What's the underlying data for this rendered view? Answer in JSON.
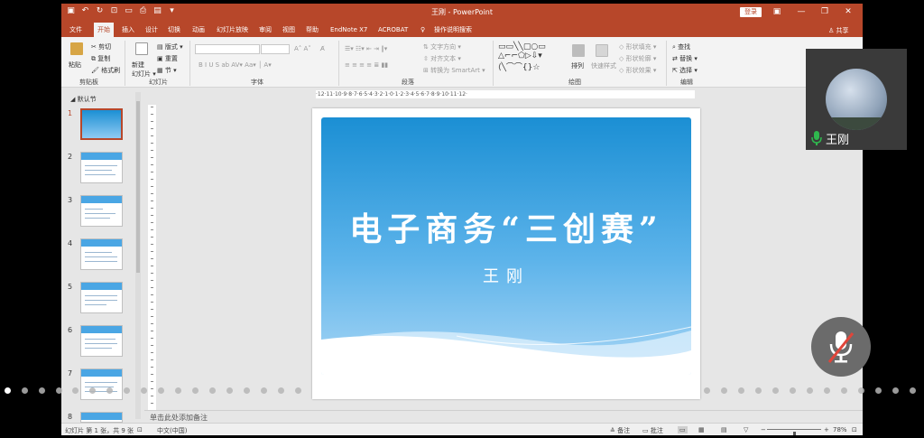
{
  "window": {
    "doc_title": "王刚 - PowerPoint",
    "login_label": "登录"
  },
  "tabs": [
    "文件",
    "开始",
    "插入",
    "设计",
    "切换",
    "动画",
    "幻灯片放映",
    "审阅",
    "视图",
    "帮助",
    "EndNote X7",
    "ACROBAT",
    "操作说明搜索"
  ],
  "active_tab": "开始",
  "share_label": "共享",
  "ribbon": {
    "clipboard": {
      "paste": "粘贴",
      "cut": "剪切",
      "copy": "复制",
      "format_painter": "格式刷",
      "label": "剪贴板"
    },
    "slides": {
      "new_slide": "新建\n幻灯片",
      "layout": "版式",
      "reset": "重置",
      "section": "节",
      "label": "幻灯片"
    },
    "font": {
      "label": "字体"
    },
    "paragraph": {
      "text_direction": "文字方向",
      "align_text": "对齐文本",
      "smartart": "转换为 SmartArt",
      "label": "段落"
    },
    "drawing": {
      "arrange": "排列",
      "quick_styles": "快速样式",
      "shape_fill": "形状填充",
      "shape_outline": "形状轮廓",
      "shape_effects": "形状效果",
      "label": "绘图"
    },
    "editing": {
      "find": "查找",
      "replace": "替换",
      "select": "选择",
      "label": "编辑"
    }
  },
  "thumbnails": {
    "section": "默认节",
    "numbers": [
      "1",
      "2",
      "3",
      "4",
      "5",
      "6",
      "7",
      "8"
    ],
    "selected": "1"
  },
  "ruler": "·12·11·10·9·8·7·6·5·4·3·2·1·0·1·2·3·4·5·6·7·8·9·10·11·12·",
  "slide": {
    "title": "电子商务“三创赛”",
    "subtitle": "王刚"
  },
  "notes_placeholder": "单击此处添加备注",
  "status": {
    "slide_info": "幻灯片 第 1 张，共 9 张",
    "language": "中文(中国)",
    "notes": "备注",
    "comments": "批注",
    "zoom": "78%",
    "zoom_fraction": 0.5
  },
  "meeting": {
    "participant_name": "王刚",
    "mic_state": "muted",
    "page_dots_active_index": 0
  },
  "colors": {
    "brand": "#b7472a",
    "slide_blue": "#1b8fd4",
    "mic_green": "#2fb84e"
  }
}
